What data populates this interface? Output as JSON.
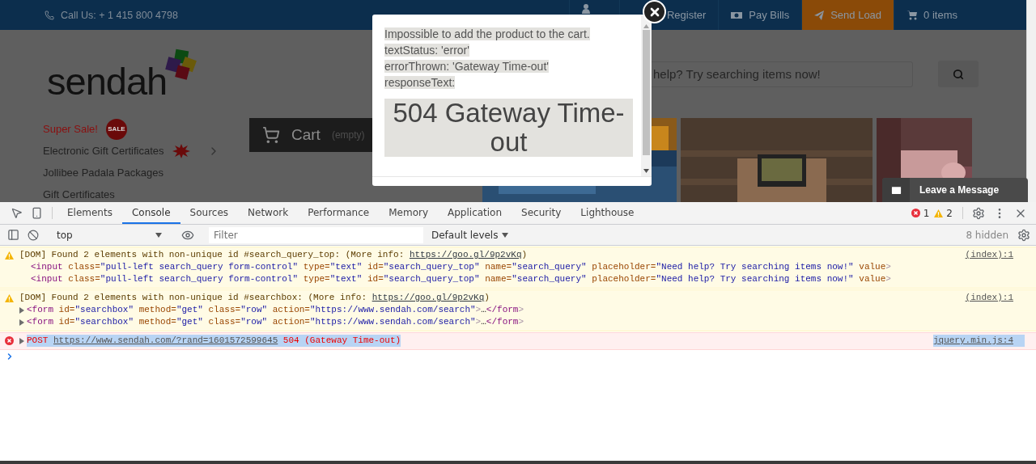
{
  "top_bar": {
    "phone": "Call Us: + 1 415 800 4798",
    "nav": [
      {
        "label": "Register",
        "highlighted": false
      },
      {
        "label": "Pay Bills",
        "highlighted": false
      },
      {
        "label": "Send Load",
        "highlighted": true
      },
      {
        "label": "0 items",
        "highlighted": false
      }
    ]
  },
  "logo": "sendah",
  "search": {
    "placeholder": "help? Try searching items now!"
  },
  "categories": [
    {
      "label": "Super Sale!",
      "kind": "sale",
      "badge": "SALE"
    },
    {
      "label": "Electronic Gift Certificates",
      "kind": "new"
    },
    {
      "label": "Jollibee Padala Packages",
      "kind": "plain"
    },
    {
      "label": "Gift Certificates",
      "kind": "plain"
    }
  ],
  "cart": {
    "label": "Cart",
    "note": "(empty)"
  },
  "chat": {
    "label": "Leave a Message"
  },
  "modal": {
    "lines": [
      "Impossible to add the product to the cart.",
      "textStatus: 'error'",
      "errorThrown: 'Gateway Time-out'",
      "responseText:"
    ],
    "heading": "504 Gateway Time-out"
  },
  "devtools": {
    "tabs": [
      {
        "label": "Elements",
        "selected": false
      },
      {
        "label": "Console",
        "selected": true
      },
      {
        "label": "Sources",
        "selected": false
      },
      {
        "label": "Network",
        "selected": false
      },
      {
        "label": "Performance",
        "selected": false
      },
      {
        "label": "Memory",
        "selected": false
      },
      {
        "label": "Application",
        "selected": false
      },
      {
        "label": "Security",
        "selected": false
      },
      {
        "label": "Lighthouse",
        "selected": false
      }
    ],
    "error_count": "1",
    "warning_count": "2",
    "context": "top",
    "filter_placeholder": "Filter",
    "levels": "Default levels",
    "hidden": "8 hidden",
    "messages": [
      {
        "kind": "warning",
        "text": "[DOM] Found 2 elements with non-unique id #search_query_top: (More info: ",
        "link": "https://goo.gl/9p2vKq",
        "suffix": ")",
        "source": "(index):1",
        "highlighted": false,
        "lines": [
          {
            "code": "<input class=\"pull-left search_query form-control\" type=\"text\" id=\"search_query_top\" name=\"search_query\" placeholder=\"Need help? Try searching items now!\" value>",
            "expandable": false
          },
          {
            "code": "<input class=\"pull-left search_query form-control\" type=\"text\" id=\"search_query_top\" name=\"search_query\" placeholder=\"Need help? Try searching items now!\" value>",
            "expandable": false
          }
        ]
      },
      {
        "kind": "warning",
        "text": "[DOM] Found 2 elements with non-unique id #searchbox: (More info: ",
        "link": "https://goo.gl/9p2vKq",
        "suffix": ")",
        "source": "(index):1",
        "highlighted": false,
        "lines": [
          {
            "code": "<form id=\"searchbox\" method=\"get\" class=\"row\" action=\"https://www.sendah.com/search\">…</form>",
            "expandable": true
          },
          {
            "code": "<form id=\"searchbox\" method=\"get\" class=\"row\" action=\"https://www.sendah.com/search\">…</form>",
            "expandable": true
          }
        ]
      },
      {
        "kind": "error",
        "text": "POST ",
        "link": "https://www.sendah.com/?rand=1601572599645",
        "suffix": " 504 (Gateway Time-out)",
        "source": "jquery.min.js:4",
        "highlighted": true,
        "expandable": true
      }
    ]
  }
}
